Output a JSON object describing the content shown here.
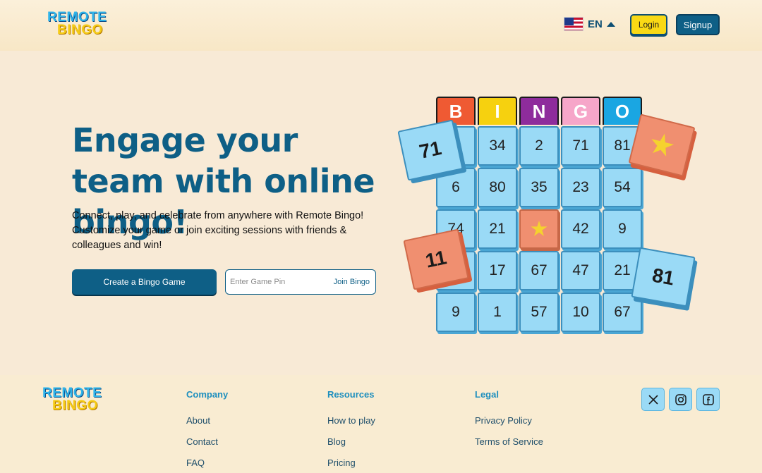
{
  "header": {
    "logo_line1": "REMOTE",
    "logo_line2": "BINGO",
    "language": "EN",
    "login_label": "Login",
    "signup_label": "Signup"
  },
  "hero": {
    "title": "Engage your team with online bingo!",
    "subtitle": "Connect, play, and celebrate from anywhere with Remote Bingo! Customize your game or join exciting sessions with friends & colleagues and win!",
    "create_label": "Create a Bingo Game",
    "pin_placeholder": "Enter Game Pin",
    "join_label": "Join Bingo"
  },
  "bingo": {
    "letters": [
      "B",
      "I",
      "N",
      "G",
      "O"
    ],
    "letter_colors": [
      "#ef5a33",
      "#f6d10f",
      "#8e2c9c",
      "#f6a6c9",
      "#1aa6e2"
    ],
    "rows": [
      [
        "",
        "34",
        "2",
        "71",
        "81"
      ],
      [
        "6",
        "80",
        "35",
        "23",
        "54"
      ],
      [
        "74",
        "21",
        "FREE",
        "42",
        "9"
      ],
      [
        "",
        "17",
        "67",
        "47",
        "21"
      ],
      [
        "9",
        "1",
        "57",
        "10",
        "67"
      ]
    ],
    "tiles": [
      "71",
      "11",
      "81"
    ]
  },
  "footer": {
    "logo_line1": "REMOTE",
    "logo_line2": "BINGO",
    "company": {
      "heading": "Company",
      "links": [
        "About",
        "Contact",
        "FAQ"
      ]
    },
    "resources": {
      "heading": "Resources",
      "links": [
        "How to play",
        "Blog",
        "Pricing"
      ]
    },
    "legal": {
      "heading": "Legal",
      "links": [
        "Privacy Policy",
        "Terms of Service"
      ]
    },
    "social_icons": [
      "x-icon",
      "instagram-icon",
      "facebook-icon"
    ]
  }
}
